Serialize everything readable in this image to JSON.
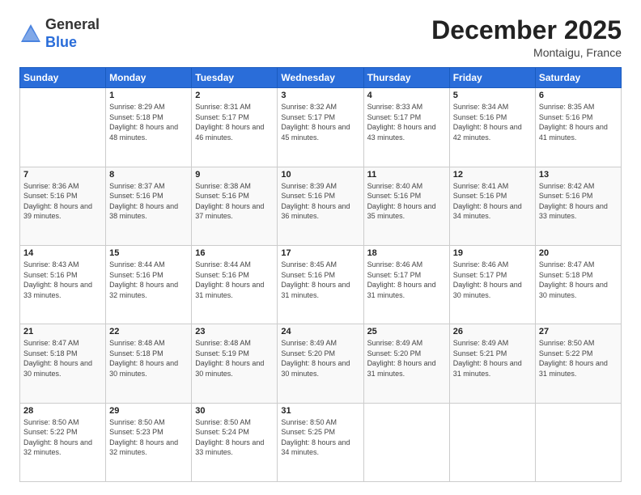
{
  "header": {
    "logo_general": "General",
    "logo_blue": "Blue",
    "month_title": "December 2025",
    "location": "Montaigu, France"
  },
  "days_of_week": [
    "Sunday",
    "Monday",
    "Tuesday",
    "Wednesday",
    "Thursday",
    "Friday",
    "Saturday"
  ],
  "weeks": [
    [
      {
        "day": "",
        "sunrise": "",
        "sunset": "",
        "daylight": ""
      },
      {
        "day": "1",
        "sunrise": "Sunrise: 8:29 AM",
        "sunset": "Sunset: 5:18 PM",
        "daylight": "Daylight: 8 hours and 48 minutes."
      },
      {
        "day": "2",
        "sunrise": "Sunrise: 8:31 AM",
        "sunset": "Sunset: 5:17 PM",
        "daylight": "Daylight: 8 hours and 46 minutes."
      },
      {
        "day": "3",
        "sunrise": "Sunrise: 8:32 AM",
        "sunset": "Sunset: 5:17 PM",
        "daylight": "Daylight: 8 hours and 45 minutes."
      },
      {
        "day": "4",
        "sunrise": "Sunrise: 8:33 AM",
        "sunset": "Sunset: 5:17 PM",
        "daylight": "Daylight: 8 hours and 43 minutes."
      },
      {
        "day": "5",
        "sunrise": "Sunrise: 8:34 AM",
        "sunset": "Sunset: 5:16 PM",
        "daylight": "Daylight: 8 hours and 42 minutes."
      },
      {
        "day": "6",
        "sunrise": "Sunrise: 8:35 AM",
        "sunset": "Sunset: 5:16 PM",
        "daylight": "Daylight: 8 hours and 41 minutes."
      }
    ],
    [
      {
        "day": "7",
        "sunrise": "Sunrise: 8:36 AM",
        "sunset": "Sunset: 5:16 PM",
        "daylight": "Daylight: 8 hours and 39 minutes."
      },
      {
        "day": "8",
        "sunrise": "Sunrise: 8:37 AM",
        "sunset": "Sunset: 5:16 PM",
        "daylight": "Daylight: 8 hours and 38 minutes."
      },
      {
        "day": "9",
        "sunrise": "Sunrise: 8:38 AM",
        "sunset": "Sunset: 5:16 PM",
        "daylight": "Daylight: 8 hours and 37 minutes."
      },
      {
        "day": "10",
        "sunrise": "Sunrise: 8:39 AM",
        "sunset": "Sunset: 5:16 PM",
        "daylight": "Daylight: 8 hours and 36 minutes."
      },
      {
        "day": "11",
        "sunrise": "Sunrise: 8:40 AM",
        "sunset": "Sunset: 5:16 PM",
        "daylight": "Daylight: 8 hours and 35 minutes."
      },
      {
        "day": "12",
        "sunrise": "Sunrise: 8:41 AM",
        "sunset": "Sunset: 5:16 PM",
        "daylight": "Daylight: 8 hours and 34 minutes."
      },
      {
        "day": "13",
        "sunrise": "Sunrise: 8:42 AM",
        "sunset": "Sunset: 5:16 PM",
        "daylight": "Daylight: 8 hours and 33 minutes."
      }
    ],
    [
      {
        "day": "14",
        "sunrise": "Sunrise: 8:43 AM",
        "sunset": "Sunset: 5:16 PM",
        "daylight": "Daylight: 8 hours and 33 minutes."
      },
      {
        "day": "15",
        "sunrise": "Sunrise: 8:44 AM",
        "sunset": "Sunset: 5:16 PM",
        "daylight": "Daylight: 8 hours and 32 minutes."
      },
      {
        "day": "16",
        "sunrise": "Sunrise: 8:44 AM",
        "sunset": "Sunset: 5:16 PM",
        "daylight": "Daylight: 8 hours and 31 minutes."
      },
      {
        "day": "17",
        "sunrise": "Sunrise: 8:45 AM",
        "sunset": "Sunset: 5:16 PM",
        "daylight": "Daylight: 8 hours and 31 minutes."
      },
      {
        "day": "18",
        "sunrise": "Sunrise: 8:46 AM",
        "sunset": "Sunset: 5:17 PM",
        "daylight": "Daylight: 8 hours and 31 minutes."
      },
      {
        "day": "19",
        "sunrise": "Sunrise: 8:46 AM",
        "sunset": "Sunset: 5:17 PM",
        "daylight": "Daylight: 8 hours and 30 minutes."
      },
      {
        "day": "20",
        "sunrise": "Sunrise: 8:47 AM",
        "sunset": "Sunset: 5:18 PM",
        "daylight": "Daylight: 8 hours and 30 minutes."
      }
    ],
    [
      {
        "day": "21",
        "sunrise": "Sunrise: 8:47 AM",
        "sunset": "Sunset: 5:18 PM",
        "daylight": "Daylight: 8 hours and 30 minutes."
      },
      {
        "day": "22",
        "sunrise": "Sunrise: 8:48 AM",
        "sunset": "Sunset: 5:18 PM",
        "daylight": "Daylight: 8 hours and 30 minutes."
      },
      {
        "day": "23",
        "sunrise": "Sunrise: 8:48 AM",
        "sunset": "Sunset: 5:19 PM",
        "daylight": "Daylight: 8 hours and 30 minutes."
      },
      {
        "day": "24",
        "sunrise": "Sunrise: 8:49 AM",
        "sunset": "Sunset: 5:20 PM",
        "daylight": "Daylight: 8 hours and 30 minutes."
      },
      {
        "day": "25",
        "sunrise": "Sunrise: 8:49 AM",
        "sunset": "Sunset: 5:20 PM",
        "daylight": "Daylight: 8 hours and 31 minutes."
      },
      {
        "day": "26",
        "sunrise": "Sunrise: 8:49 AM",
        "sunset": "Sunset: 5:21 PM",
        "daylight": "Daylight: 8 hours and 31 minutes."
      },
      {
        "day": "27",
        "sunrise": "Sunrise: 8:50 AM",
        "sunset": "Sunset: 5:22 PM",
        "daylight": "Daylight: 8 hours and 31 minutes."
      }
    ],
    [
      {
        "day": "28",
        "sunrise": "Sunrise: 8:50 AM",
        "sunset": "Sunset: 5:22 PM",
        "daylight": "Daylight: 8 hours and 32 minutes."
      },
      {
        "day": "29",
        "sunrise": "Sunrise: 8:50 AM",
        "sunset": "Sunset: 5:23 PM",
        "daylight": "Daylight: 8 hours and 32 minutes."
      },
      {
        "day": "30",
        "sunrise": "Sunrise: 8:50 AM",
        "sunset": "Sunset: 5:24 PM",
        "daylight": "Daylight: 8 hours and 33 minutes."
      },
      {
        "day": "31",
        "sunrise": "Sunrise: 8:50 AM",
        "sunset": "Sunset: 5:25 PM",
        "daylight": "Daylight: 8 hours and 34 minutes."
      },
      {
        "day": "",
        "sunrise": "",
        "sunset": "",
        "daylight": ""
      },
      {
        "day": "",
        "sunrise": "",
        "sunset": "",
        "daylight": ""
      },
      {
        "day": "",
        "sunrise": "",
        "sunset": "",
        "daylight": ""
      }
    ]
  ]
}
